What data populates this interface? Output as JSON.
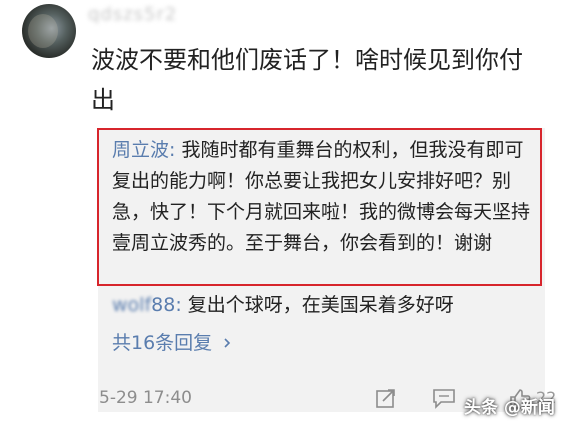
{
  "comment": {
    "username_blurred": "qdszs5r2",
    "text": "波波不要和他们废话了！啥时候见到你付出"
  },
  "replies": {
    "main": {
      "author": "周立波",
      "separator": ": ",
      "text": "我随时都有重舞台的权利，但我没有即可复出的能力啊！你总要让我把女儿安排好吧？别急，快了！下个月就回来啦！我的微博会每天坚持壹周立波秀的。至于舞台，你会看到的！谢谢"
    },
    "second": {
      "author_blurred": "wolf",
      "author_suffix": "88",
      "separator": ": ",
      "text": "复出个球呀，在美国呆着多好呀"
    },
    "more_label": "共16条回复"
  },
  "footer": {
    "timestamp": "5-29 17:40",
    "like_count": "22",
    "watermark": "头条 @新闻"
  },
  "colors": {
    "author_link": "#5a7dae",
    "highlight_border": "#d7252c",
    "reply_bg": "#f2f2f2"
  }
}
